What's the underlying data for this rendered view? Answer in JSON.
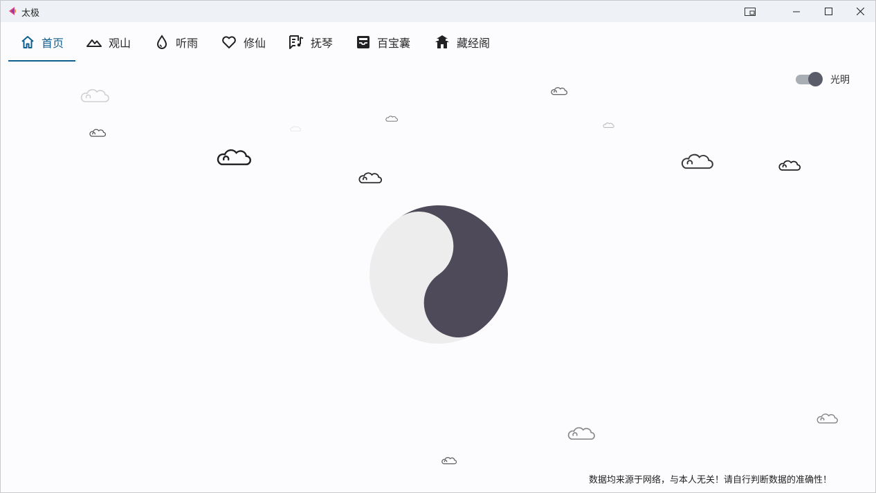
{
  "window": {
    "title": "太极",
    "controls": [
      "minimize",
      "maximize",
      "close"
    ]
  },
  "nav": {
    "items": [
      {
        "label": "首页",
        "icon": "home-icon",
        "active": true
      },
      {
        "label": "观山",
        "icon": "mountain-icon",
        "active": false
      },
      {
        "label": "听雨",
        "icon": "water-drop-icon",
        "active": false
      },
      {
        "label": "修仙",
        "icon": "heart-icon",
        "active": false
      },
      {
        "label": "抚琴",
        "icon": "music-note-icon",
        "active": false
      },
      {
        "label": "百宝囊",
        "icon": "inbox-icon",
        "active": false
      },
      {
        "label": "藏经阁",
        "icon": "pagoda-icon",
        "active": false
      }
    ],
    "accent": "#0e5f8f"
  },
  "theme_toggle": {
    "label": "光明",
    "on": true
  },
  "footer": {
    "disclaimer": "数据均来源于网络，与本人无关！请自行判断数据的准确性！"
  },
  "colors": {
    "yin": "#4f4a59",
    "yang": "#ededed",
    "background": "#fcfcfe"
  }
}
